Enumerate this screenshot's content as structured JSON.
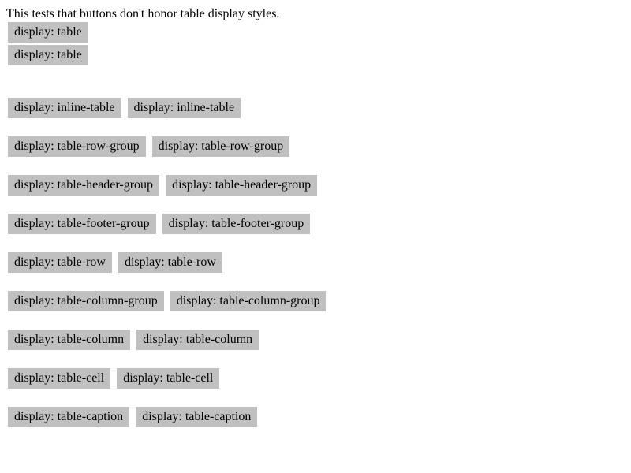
{
  "intro_text": "This tests that buttons don't honor table display styles.",
  "button_style": {
    "background": "#c0c0c0"
  },
  "stacked_buttons": [
    {
      "label": "display: table"
    },
    {
      "label": "display: table"
    }
  ],
  "button_rows": [
    {
      "display": "inline-table",
      "labels": [
        "display: inline-table",
        "display: inline-table"
      ]
    },
    {
      "display": "table-row-group",
      "labels": [
        "display: table-row-group",
        "display: table-row-group"
      ]
    },
    {
      "display": "table-header-group",
      "labels": [
        "display: table-header-group",
        "display: table-header-group"
      ]
    },
    {
      "display": "table-footer-group",
      "labels": [
        "display: table-footer-group",
        "display: table-footer-group"
      ]
    },
    {
      "display": "table-row",
      "labels": [
        "display: table-row",
        "display: table-row"
      ]
    },
    {
      "display": "table-column-group",
      "labels": [
        "display: table-column-group",
        "display: table-column-group"
      ]
    },
    {
      "display": "table-column",
      "labels": [
        "display: table-column",
        "display: table-column"
      ]
    },
    {
      "display": "table-cell",
      "labels": [
        "display: table-cell",
        "display: table-cell"
      ]
    },
    {
      "display": "table-caption",
      "labels": [
        "display: table-caption",
        "display: table-caption"
      ]
    }
  ]
}
